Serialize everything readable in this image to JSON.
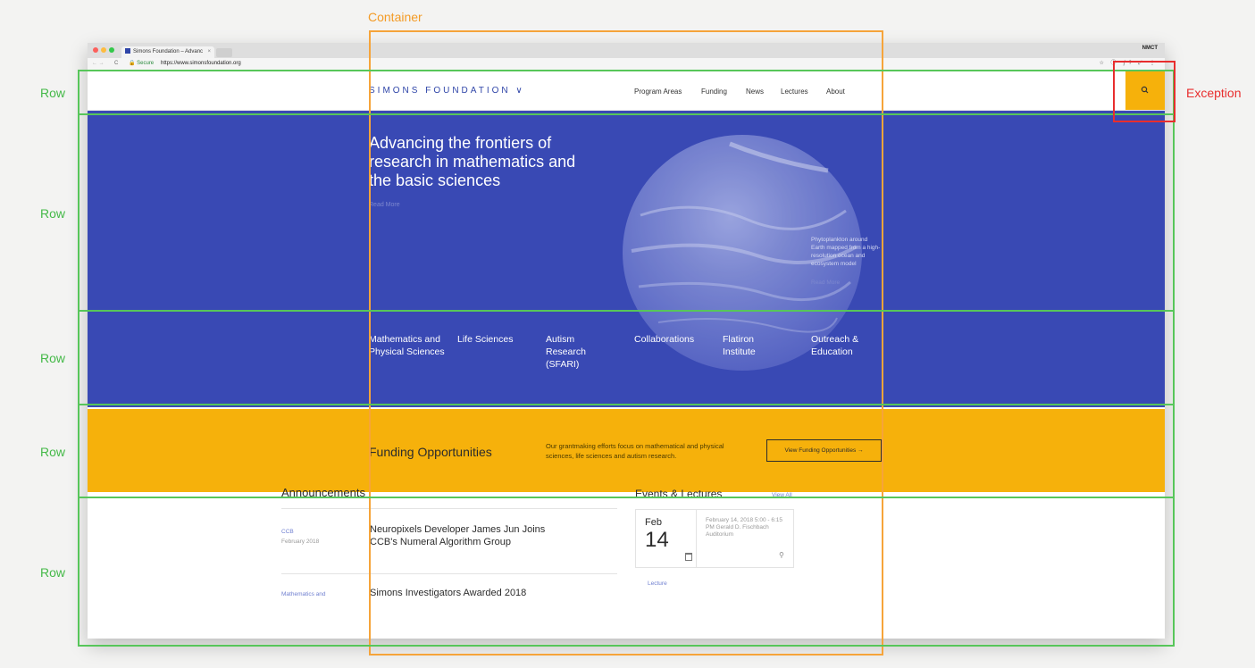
{
  "browser": {
    "tab_title": "Simons Foundation – Advanc",
    "tab_close": "×",
    "user": "NMCT",
    "nav_arrows": "← →",
    "reload": "C",
    "secure_label": "🔒 Secure",
    "url": "https://www.simonsfoundation.org",
    "extensions": "☆ ⓘ ƒ? ⤢ ⋮",
    "traffic_colors": [
      "#fc605c",
      "#fdbc40",
      "#34c84a"
    ]
  },
  "header": {
    "logo": "SIMONS FOUNDATION",
    "logo_chevron": "∨",
    "nav": [
      "Program Areas",
      "Funding",
      "News",
      "Lectures",
      "About"
    ],
    "search_icon": "search-icon"
  },
  "hero": {
    "title": "Advancing the frontiers of research in mathematics and the basic sciences",
    "read_more": "Read More",
    "caption": "Phytoplankton around Earth mapped from a high-resolution ocean and ecosystem model",
    "caption_more": "Read More"
  },
  "program_areas": [
    "Mathematics and Physical Sciences",
    "Life Sciences",
    "Autism Research (SFARI)",
    "Collaborations",
    "Flatiron Institute",
    "Outreach & Education"
  ],
  "funding": {
    "title": "Funding Opportunities",
    "description": "Our grantmaking efforts focus on mathematical and physical sciences, life sciences and autism research.",
    "button": "View Funding Opportunities →"
  },
  "announcements": {
    "title": "Announcements",
    "items": [
      {
        "category": "CCB",
        "date": "February 2018",
        "headline": "Neuropixels Developer James Jun Joins CCB's Numeral Algorithm Group"
      },
      {
        "category": "Mathematics and",
        "headline": "Simons Investigators Awarded 2018"
      }
    ]
  },
  "events": {
    "title": "Events & Lectures",
    "view_all": "View All",
    "card": {
      "month": "Feb",
      "day": "14",
      "info": "February 14, 2018 5:00 - 6:15 PM Gerald D. Fischbach Auditorium",
      "pin_icon": "⚲",
      "type": "Lecture"
    }
  },
  "annotations": {
    "container": "Container",
    "row": "Row",
    "exception": "Exception"
  }
}
